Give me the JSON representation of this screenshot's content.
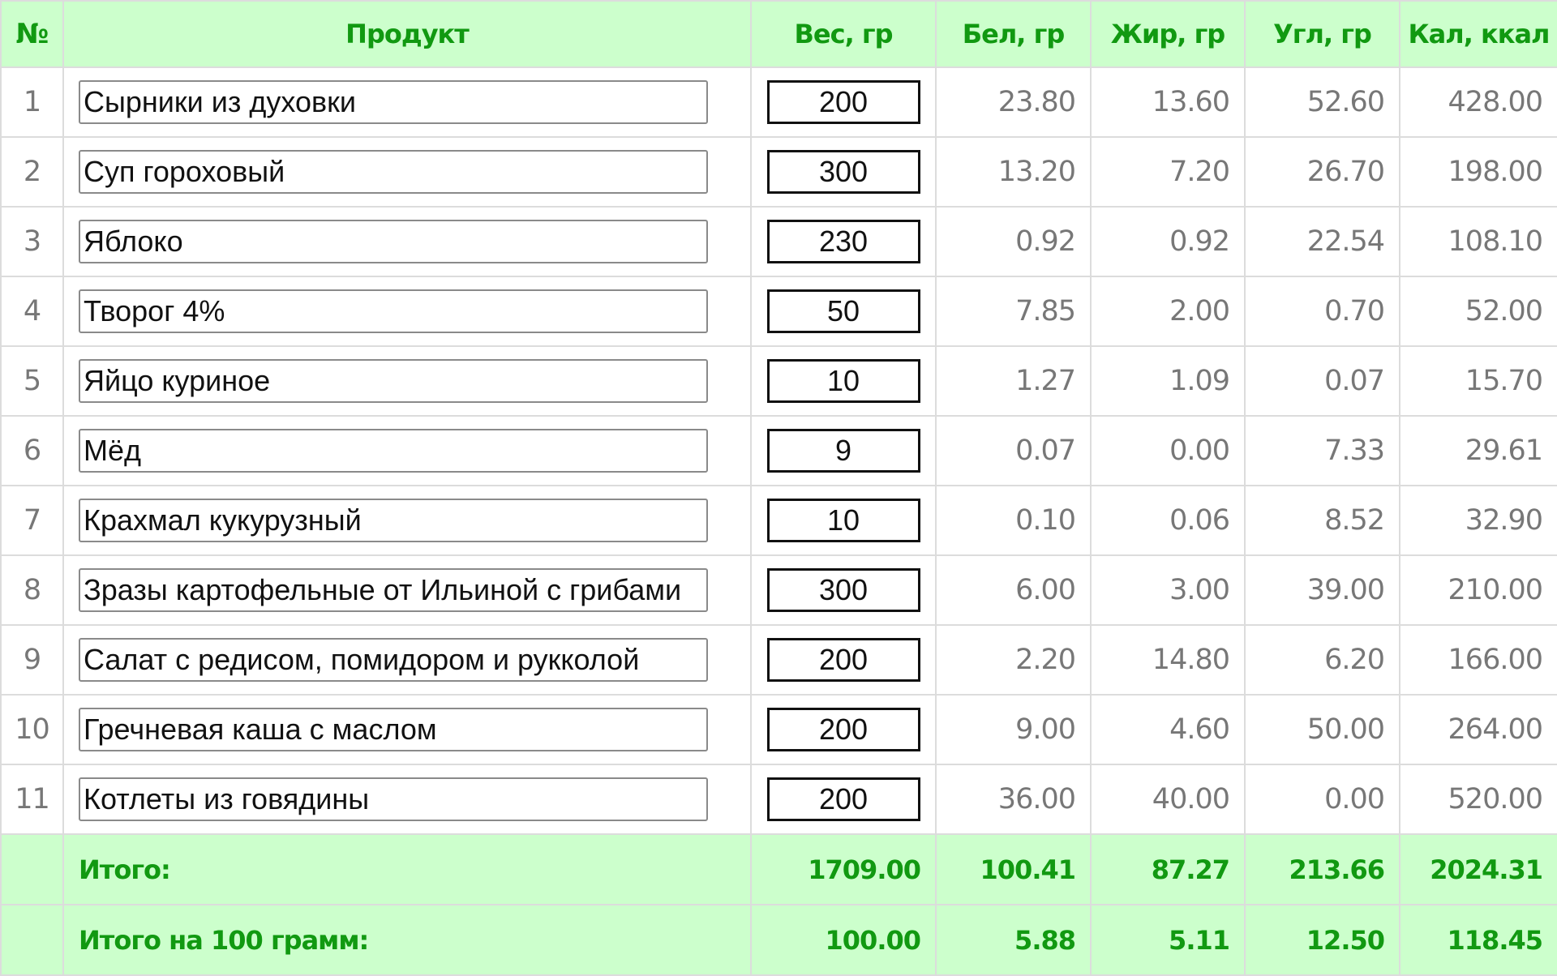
{
  "header": {
    "num": "№",
    "product": "Продукт",
    "weight": "Вес, гр",
    "protein": "Бел, гр",
    "fat": "Жир, гр",
    "carbs": "Угл, гр",
    "calories": "Кал, ккал"
  },
  "rows": [
    {
      "num": "1",
      "name": "Сырники из духовки",
      "weight": "200",
      "protein": "23.80",
      "fat": "13.60",
      "carbs": "52.60",
      "calories": "428.00"
    },
    {
      "num": "2",
      "name": "Суп гороховый",
      "weight": "300",
      "protein": "13.20",
      "fat": "7.20",
      "carbs": "26.70",
      "calories": "198.00"
    },
    {
      "num": "3",
      "name": "Яблоко",
      "weight": "230",
      "protein": "0.92",
      "fat": "0.92",
      "carbs": "22.54",
      "calories": "108.10"
    },
    {
      "num": "4",
      "name": "Творог 4%",
      "weight": "50",
      "protein": "7.85",
      "fat": "2.00",
      "carbs": "0.70",
      "calories": "52.00"
    },
    {
      "num": "5",
      "name": "Яйцо куриное",
      "weight": "10",
      "protein": "1.27",
      "fat": "1.09",
      "carbs": "0.07",
      "calories": "15.70"
    },
    {
      "num": "6",
      "name": "Мёд",
      "weight": "9",
      "protein": "0.07",
      "fat": "0.00",
      "carbs": "7.33",
      "calories": "29.61"
    },
    {
      "num": "7",
      "name": "Крахмал кукурузный",
      "weight": "10",
      "protein": "0.10",
      "fat": "0.06",
      "carbs": "8.52",
      "calories": "32.90"
    },
    {
      "num": "8",
      "name": "Зразы картофельные от Ильиной с грибами",
      "weight": "300",
      "protein": "6.00",
      "fat": "3.00",
      "carbs": "39.00",
      "calories": "210.00"
    },
    {
      "num": "9",
      "name": "Салат с редисом, помидором и рукколой",
      "weight": "200",
      "protein": "2.20",
      "fat": "14.80",
      "carbs": "6.20",
      "calories": "166.00"
    },
    {
      "num": "10",
      "name": "Гречневая каша с маслом",
      "weight": "200",
      "protein": "9.00",
      "fat": "4.60",
      "carbs": "50.00",
      "calories": "264.00"
    },
    {
      "num": "11",
      "name": "Котлеты из говядины",
      "weight": "200",
      "protein": "36.00",
      "fat": "40.00",
      "carbs": "0.00",
      "calories": "520.00"
    }
  ],
  "totals": {
    "label": "Итого:",
    "weight": "1709.00",
    "protein": "100.41",
    "fat": "87.27",
    "carbs": "213.66",
    "calories": "2024.31"
  },
  "per100": {
    "label": "Итого на 100 грамм:",
    "weight": "100.00",
    "protein": "5.88",
    "fat": "5.11",
    "carbs": "12.50",
    "calories": "118.45"
  },
  "colors": {
    "header_bg": "#ccffcc",
    "header_text": "#119911",
    "value_text": "#777777"
  }
}
